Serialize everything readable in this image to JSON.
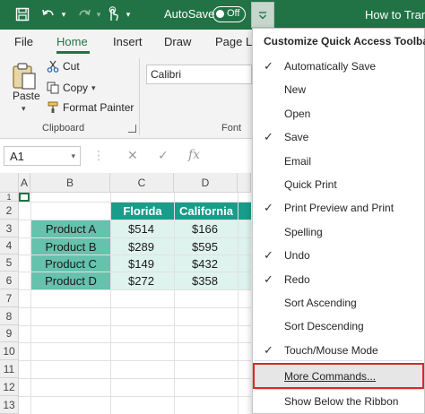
{
  "titlebar": {
    "autosave_label": "AutoSave",
    "autosave_state": "Off",
    "title": "How to Trans",
    "colors": {
      "bar": "#217346"
    }
  },
  "ribbon": {
    "tabs": [
      "File",
      "Home",
      "Insert",
      "Draw",
      "Page La"
    ],
    "active_tab": "Home",
    "paste_label": "Paste",
    "clipboard_items": [
      "Cut",
      "Copy",
      "Format Painter"
    ],
    "clipboard_group_label": "Clipboard",
    "font_name": "Calibri",
    "font_group_label": "Font"
  },
  "formula_bar": {
    "name_box": "A1",
    "fx_symbol": "fx"
  },
  "sheet": {
    "columns": [
      "A",
      "B",
      "C",
      "D"
    ],
    "rows": [
      "1",
      "2",
      "3",
      "4",
      "5",
      "6",
      "7",
      "8",
      "9",
      "10",
      "11",
      "12",
      "13"
    ],
    "headers": [
      "Florida",
      "California"
    ],
    "table": [
      {
        "product": "Product A",
        "florida": "$514",
        "california": "$166"
      },
      {
        "product": "Product B",
        "florida": "$289",
        "california": "$595"
      },
      {
        "product": "Product C",
        "florida": "$149",
        "california": "$432"
      },
      {
        "product": "Product D",
        "florida": "$272",
        "california": "$358"
      }
    ],
    "colors": {
      "header": "#1a9c8a",
      "product": "#66c2ad",
      "values": "#dff3ee"
    }
  },
  "menu": {
    "title": "Customize Quick Access Toolbar",
    "items": [
      {
        "label": "Automatically Save",
        "checked": "✓"
      },
      {
        "label": "New",
        "checked": ""
      },
      {
        "label": "Open",
        "checked": ""
      },
      {
        "label": "Save",
        "checked": "✓"
      },
      {
        "label": "Email",
        "checked": ""
      },
      {
        "label": "Quick Print",
        "checked": ""
      },
      {
        "label": "Print Preview and Print",
        "checked": "✓"
      },
      {
        "label": "Spelling",
        "checked": ""
      },
      {
        "label": "Undo",
        "checked": "✓"
      },
      {
        "label": "Redo",
        "checked": "✓"
      },
      {
        "label": "Sort Ascending",
        "checked": ""
      },
      {
        "label": "Sort Descending",
        "checked": ""
      },
      {
        "label": "Touch/Mouse Mode",
        "checked": "✓"
      }
    ],
    "more_commands": "More Commands...",
    "show_below": "Show Below the Ribbon",
    "highlight_color": "#e0262a"
  },
  "icons": [
    "save-icon",
    "undo-icon",
    "redo-icon",
    "touch-mode-icon",
    "customize-qat-icon",
    "paste-icon",
    "cut-icon",
    "copy-icon",
    "format-painter-icon",
    "dialog-launcher-icon"
  ]
}
